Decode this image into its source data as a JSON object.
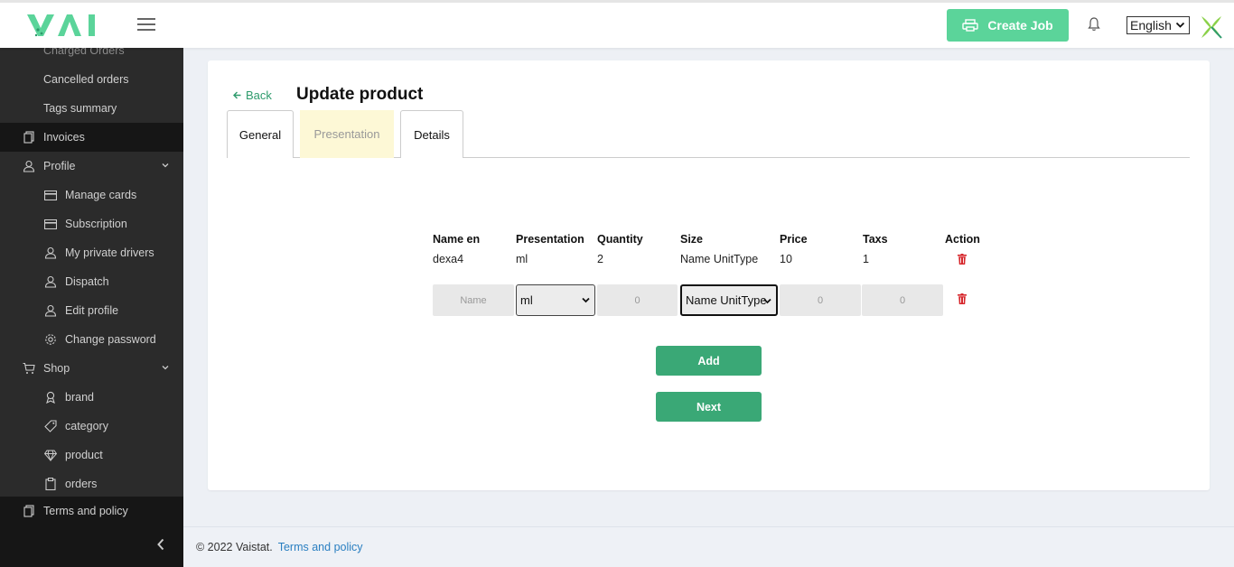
{
  "header": {
    "create_job_label": "Create Job",
    "language": "English"
  },
  "sidebar": {
    "partial_item": "Charged Orders",
    "items": [
      {
        "label": "Cancelled orders"
      },
      {
        "label": "Tags summary"
      },
      {
        "label": "Invoices"
      },
      {
        "label": "Profile"
      },
      {
        "label": "Manage cards"
      },
      {
        "label": "Subscription"
      },
      {
        "label": "My private drivers"
      },
      {
        "label": "Dispatch"
      },
      {
        "label": "Edit profile"
      },
      {
        "label": "Change password"
      },
      {
        "label": "Shop"
      },
      {
        "label": "brand"
      },
      {
        "label": "category"
      },
      {
        "label": "product"
      },
      {
        "label": "orders"
      },
      {
        "label": "Terms and policy"
      }
    ]
  },
  "main": {
    "back_label": "Back",
    "title": "Update product",
    "tabs": [
      {
        "label": "General"
      },
      {
        "label": "Presentation"
      },
      {
        "label": "Details"
      }
    ],
    "table": {
      "headers": [
        "Name en",
        "Presentation",
        "Quantity",
        "Size",
        "Price",
        "Taxs",
        "Action"
      ],
      "rows": [
        [
          "dexa4",
          "ml",
          "2",
          "Name UnitType",
          "10",
          "1"
        ]
      ]
    },
    "form": {
      "name_placeholder": "Name",
      "presentation_value": "ml",
      "quantity_placeholder": "0",
      "size_value": "Name UnitType",
      "price_placeholder": "0",
      "taxs_placeholder": "0"
    },
    "add_label": "Add",
    "next_label": "Next"
  },
  "footer": {
    "copyright": "© 2022 Vaistat.",
    "terms_link": "Terms and policy"
  },
  "colors": {
    "brand_green": "#5bd49a",
    "button_green": "#3aa876",
    "sidebar_bg": "#2b2b2b",
    "active_tab_bg": "#fdf8d6",
    "danger_red": "#d6262b"
  }
}
